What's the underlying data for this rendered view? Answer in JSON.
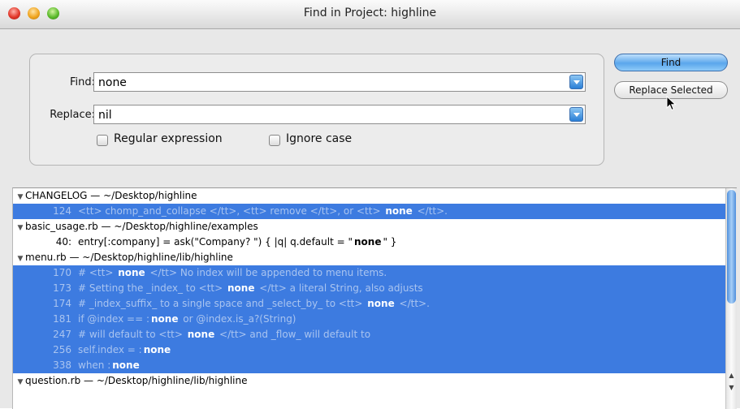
{
  "window": {
    "title": "Find in Project: highline"
  },
  "form": {
    "find_label": "Find:",
    "find_value": "none",
    "replace_label": "Replace:",
    "replace_value": "nil",
    "regex_label": "Regular expression",
    "regex_checked": false,
    "ignore_case_label": "Ignore case",
    "ignore_case_checked": false
  },
  "buttons": {
    "find": "Find",
    "replace_selected": "Replace Selected"
  },
  "results": [
    {
      "type": "group",
      "label": "CHANGELOG — ~/Desktop/highline"
    },
    {
      "type": "hit",
      "selected": true,
      "line": "124",
      "before": "<tt> chomp_and_collapse </tt>, <tt> remove </tt>, or <tt> ",
      "match": "none",
      "after": " </tt>."
    },
    {
      "type": "group",
      "label": "basic_usage.rb — ~/Desktop/highline/examples"
    },
    {
      "type": "hit",
      "selected": false,
      "line": "40:",
      "before": "entry[:company]     = ask(\"Company?  \") { |q| q.default = \"",
      "match": "none",
      "after": "\" }"
    },
    {
      "type": "group",
      "label": "menu.rb — ~/Desktop/highline/lib/highline"
    },
    {
      "type": "hit",
      "selected": true,
      "line": "170",
      "before": "# <tt> ",
      "match": "none",
      "after": " </tt>       No index will be appended to menu items."
    },
    {
      "type": "hit",
      "selected": true,
      "line": "173",
      "before": "# Setting the _index_ to <tt> ",
      "match": "none",
      "after": " </tt> a literal String, also adjusts"
    },
    {
      "type": "hit",
      "selected": true,
      "line": "174",
      "before": "# _index_suffix_ to a single space and _select_by_ to <tt> ",
      "match": "none",
      "after": " </tt>."
    },
    {
      "type": "hit",
      "selected": true,
      "line": "181",
      "before": "if @index == :",
      "match": "none",
      "after": " or @index.is_a?(String)"
    },
    {
      "type": "hit",
      "selected": true,
      "line": "247",
      "before": "# will default to <tt> ",
      "match": "none",
      "after": " </tt> and _flow_ will default to"
    },
    {
      "type": "hit",
      "selected": true,
      "line": "256",
      "before": "self.index = :",
      "match": "none",
      "after": ""
    },
    {
      "type": "hit",
      "selected": true,
      "line": "338",
      "before": "when :",
      "match": "none",
      "after": ""
    },
    {
      "type": "group",
      "label": "question.rb — ~/Desktop/highline/lib/highline"
    }
  ]
}
